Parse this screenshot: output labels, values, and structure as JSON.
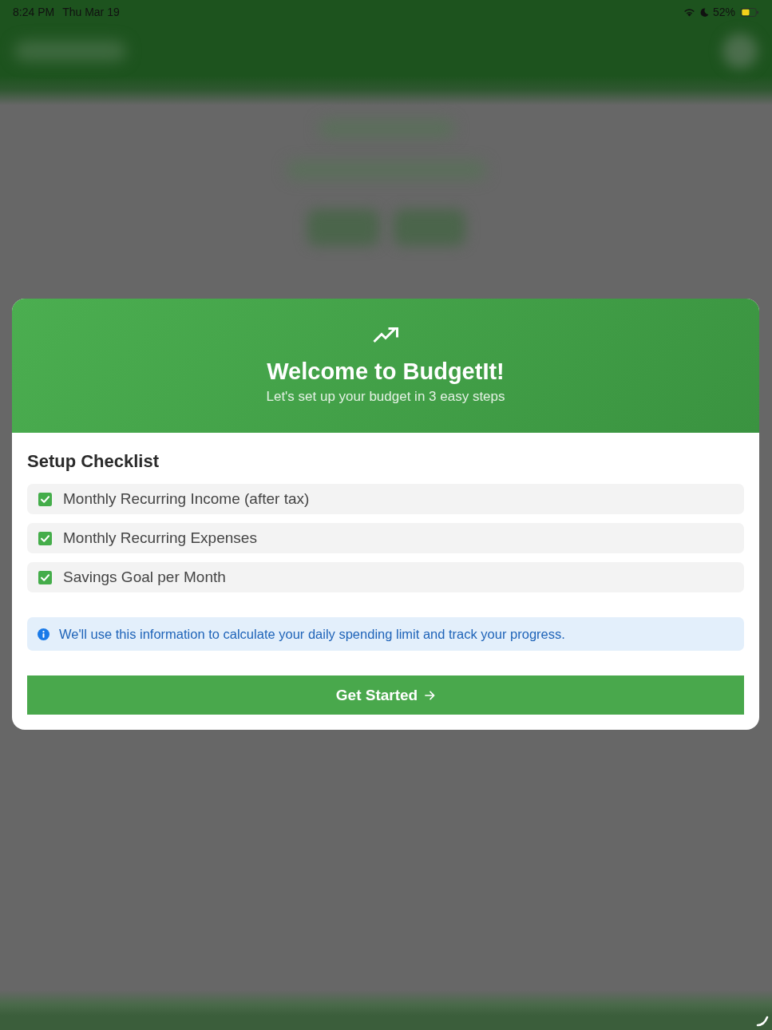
{
  "status_bar": {
    "time": "8:24 PM",
    "date": "Thu Mar 19",
    "battery": "52%"
  },
  "dialog": {
    "title": "Welcome to BudgetIt!",
    "subtitle": "Let's set up your budget in 3 easy steps",
    "checklist": {
      "title": "Setup Checklist",
      "items": [
        {
          "label": "Monthly Recurring Income (after tax)",
          "checked": true
        },
        {
          "label": "Monthly Recurring Expenses",
          "checked": true
        },
        {
          "label": "Savings Goal per Month",
          "checked": true
        }
      ]
    },
    "info": "We'll use this information to calculate your daily spending limit and track your progress.",
    "button": {
      "label": "Get Started"
    }
  }
}
